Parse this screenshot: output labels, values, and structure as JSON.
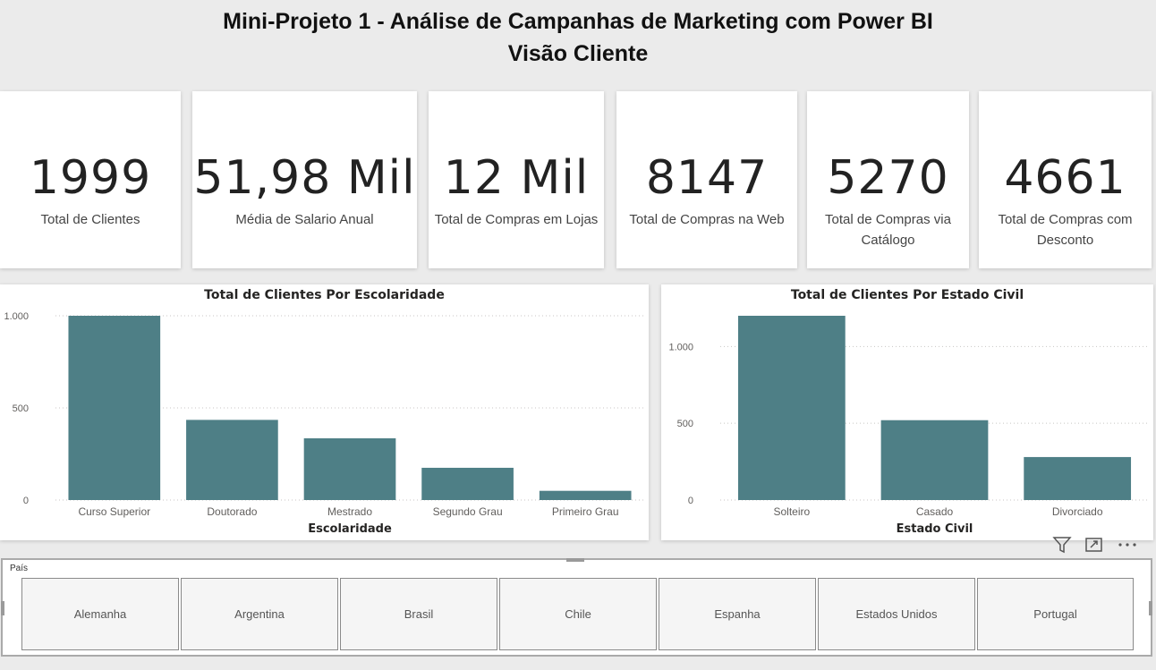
{
  "header": {
    "title": "Mini-Projeto 1 - Análise de Campanhas de Marketing com Power BI",
    "subtitle": "Visão Cliente"
  },
  "kpis": [
    {
      "value": "1999",
      "label": "Total de Clientes"
    },
    {
      "value": "51,98 Mil",
      "label": "Média de Salario Anual"
    },
    {
      "value": "12 Mil",
      "label": "Total de Compras em Lojas"
    },
    {
      "value": "8147",
      "label": "Total de Compras na Web"
    },
    {
      "value": "5270",
      "label": "Total de Compras via Catálogo"
    },
    {
      "value": "4661",
      "label": "Total de Compras com Desconto"
    }
  ],
  "chart_data": [
    {
      "type": "bar",
      "title": "Total de Clientes Por Escolaridade",
      "xlabel": "Escolaridade",
      "ylabel": "",
      "categories": [
        "Curso Superior",
        "Doutorado",
        "Mestrado",
        "Segundo Grau",
        "Primeiro Grau"
      ],
      "values": [
        1000,
        435,
        335,
        175,
        50
      ],
      "yticks": [
        0,
        500,
        1000
      ],
      "ytick_labels": [
        "0",
        "500",
        "1.000"
      ],
      "ylim": [
        0,
        1000
      ],
      "grid": true,
      "color": "#4e7f86"
    },
    {
      "type": "bar",
      "title": "Total de Clientes Por Estado Civil",
      "xlabel": "Estado Civil",
      "ylabel": "",
      "categories": [
        "Solteiro",
        "Casado",
        "Divorciado"
      ],
      "values": [
        1200,
        520,
        280
      ],
      "yticks": [
        0,
        500,
        1000
      ],
      "ytick_labels": [
        "0",
        "500",
        "1.000"
      ],
      "ylim": [
        0,
        1200
      ],
      "grid": true,
      "color": "#4e7f86"
    }
  ],
  "slicer": {
    "label": "País",
    "options": [
      "Alemanha",
      "Argentina",
      "Brasil",
      "Chile",
      "Espanha",
      "Estados Unidos",
      "Portugal"
    ]
  },
  "toolbar_icons": [
    "filter-icon",
    "focus-mode-icon",
    "more-options-icon"
  ]
}
